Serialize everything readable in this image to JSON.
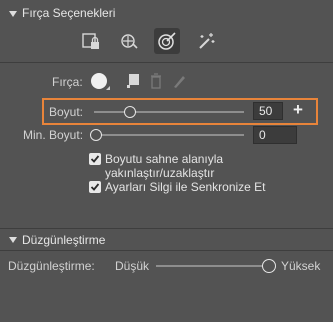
{
  "brush_options": {
    "title": "Fırça Seçenekleri",
    "tool_icons": [
      "lock-brush-icon",
      "brush-mode-icon",
      "target-brush-icon",
      "magic-wand-brush-icon"
    ],
    "brush": {
      "label": "Fırça:",
      "icons": [
        "brush-preview-circle-icon",
        "brush-copy-icon",
        "trash-icon",
        "pencil-icon"
      ]
    },
    "size": {
      "label": "Boyut:",
      "value": "50",
      "slider_fraction": 0.23,
      "plus": "+"
    },
    "min_size": {
      "label": "Min. Boyut:",
      "value": "0",
      "slider_fraction": 0.0
    },
    "checkboxes": [
      {
        "label": "Boyutu sahne alanıyla yakınlaştır/uzaklaştır",
        "checked": true
      },
      {
        "label": "Ayarları Silgi ile Senkronize Et",
        "checked": true
      }
    ]
  },
  "smoothing": {
    "title": "Düzgünleştirme",
    "label": "Düzgünleştirme:",
    "low": "Düşük",
    "high": "Yüksek",
    "slider_fraction": 1.0
  },
  "colors": {
    "highlight": "#e8843a",
    "panel_bg": "#535353"
  }
}
